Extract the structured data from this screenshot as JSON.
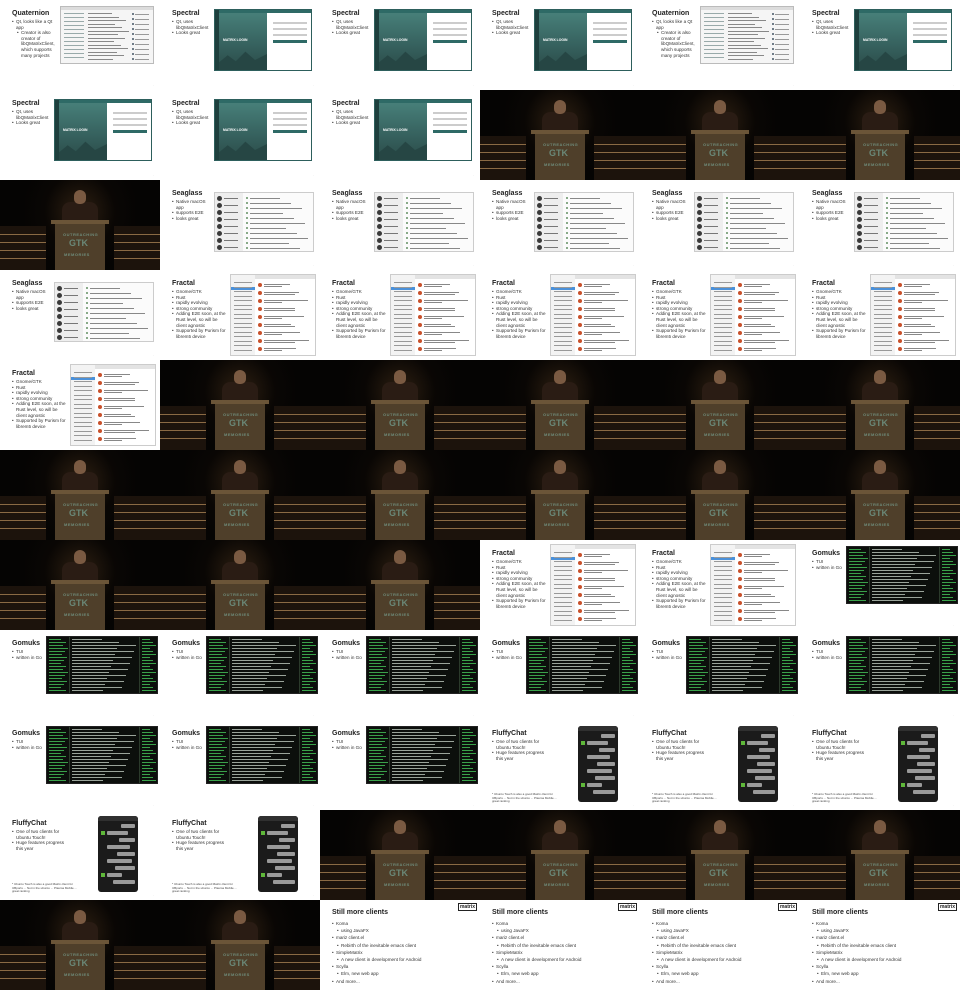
{
  "slides": {
    "quaternion": {
      "title": "Quaternion",
      "bullets": [
        {
          "text": "Qt, looks like a Qt app",
          "sub": false
        },
        {
          "text": "Creator is also creator of libQMatrixClient, which supports many projects",
          "sub": true
        }
      ]
    },
    "spectral": {
      "title": "Spectral",
      "bullets": [
        {
          "text": "Qt, uses libQMatrixClient",
          "sub": false
        },
        {
          "text": "Looks great",
          "sub": false
        }
      ],
      "screen_text": "MATRIX LOGIN"
    },
    "seaglass": {
      "title": "Seaglass",
      "bullets": [
        {
          "text": "Native macOS app",
          "sub": false
        },
        {
          "text": "supports E2E",
          "sub": false
        },
        {
          "text": "looks great",
          "sub": false
        }
      ]
    },
    "fractal": {
      "title": "Fractal",
      "bullets": [
        {
          "text": "Gnome/GTK",
          "sub": false
        },
        {
          "text": "Rust",
          "sub": false
        },
        {
          "text": "rapidly evolving",
          "sub": false
        },
        {
          "text": "strong community",
          "sub": false
        },
        {
          "text": "Adding E2E soon, at the Rust level, so will be client agnostic",
          "sub": false
        },
        {
          "text": "Supported by Purism for librem5 device",
          "sub": false
        }
      ]
    },
    "gomuks": {
      "title": "Gomuks",
      "bullets": [
        {
          "text": "TUI",
          "sub": false
        },
        {
          "text": "written in Go",
          "sub": false
        }
      ]
    },
    "fluffychat": {
      "title": "FluffyChat",
      "bullets": [
        {
          "text": "One of two clients for Ubuntu Touch!",
          "sub": false
        },
        {
          "text": "Huge features progress this year",
          "sub": false
        }
      ],
      "footnote": "* Ubuntu Touch is also a good Matrix client for UBports ... Not in the ubuntu ... Plasma Mobile ... great ranking"
    },
    "still_more": {
      "title": "Still more clients",
      "logo": "matrix",
      "bullets": [
        {
          "text": "Koma",
          "sub": false
        },
        {
          "text": "using JavaFX",
          "sub": true
        },
        {
          "text": "mariz client.el",
          "sub": false
        },
        {
          "text": "Rebirth of the inevitable emacs client",
          "sub": true
        },
        {
          "text": "SimpleMatrix",
          "sub": false
        },
        {
          "text": "A new client in development for Android",
          "sub": true
        },
        {
          "text": "Scylla",
          "sub": false
        },
        {
          "text": "Elm, new web app",
          "sub": true
        },
        {
          "text": "And more...",
          "sub": false
        }
      ]
    },
    "stage": {
      "podium_line1": "OUTREACHING",
      "podium_line2": "GTK",
      "podium_line3": "MEMORIES"
    }
  },
  "tiles": [
    "quaternion",
    "spectral",
    "spectral",
    "spectral",
    "quaternion",
    "spectral",
    "spectral",
    "spectral",
    "spectral",
    "stage",
    "stage",
    "stage",
    "stage",
    "seaglass",
    "seaglass",
    "seaglass",
    "seaglass",
    "seaglass",
    "seaglass",
    "fractal",
    "fractal",
    "fractal",
    "fractal",
    "fractal",
    "fractal",
    "stage",
    "stage",
    "stage",
    "stage",
    "stage",
    "stage",
    "stage",
    "stage",
    "stage",
    "stage",
    "stage",
    "stage",
    "stage",
    "stage",
    "fractal",
    "fractal",
    "gomuks",
    "gomuks",
    "gomuks",
    "gomuks",
    "gomuks",
    "gomuks",
    "gomuks",
    "gomuks",
    "gomuks",
    "gomuks",
    "fluffychat",
    "fluffychat",
    "fluffychat",
    "fluffychat",
    "fluffychat",
    "stage",
    "stage",
    "stage",
    "stage",
    "stage",
    "stage",
    "still_more",
    "still_more",
    "still_more",
    "still_more"
  ]
}
